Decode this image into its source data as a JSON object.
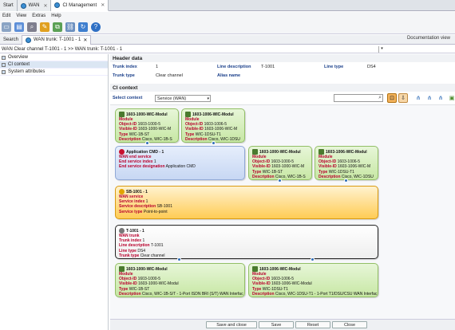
{
  "app_tabs": [
    {
      "label": "Start"
    },
    {
      "label": "WAN"
    },
    {
      "label": "CI Management"
    }
  ],
  "menu": [
    "Edit",
    "View",
    "Extras",
    "Help"
  ],
  "toolbar_icons": [
    "new-icon",
    "open-icon",
    "edit-icon",
    "copy-icon",
    "link-icon",
    "refresh-icon",
    "help-icon"
  ],
  "sub_tabs": {
    "search": "Search",
    "wan_trunk": "WAN trunk: T-1001 - 1",
    "doc_view": "Documentation view"
  },
  "breadcrumb": "WAN Clear channel T-1001 - 1 >> WAN trunk: T-1001 - 1",
  "sidebar": [
    {
      "label": "Overview"
    },
    {
      "label": "CI context"
    },
    {
      "label": "System attributes"
    }
  ],
  "header": {
    "title": "Header data",
    "trunk_index_label": "Trunk index",
    "trunk_index": "1",
    "line_desc_label": "Line description",
    "line_desc": "T-1001",
    "line_type_label": "Line type",
    "line_type": "DS4",
    "trunk_type_label": "Trunk type",
    "trunk_type": "Clear channel",
    "alias_label": "Alias name"
  },
  "ci_context": {
    "title": "CI context",
    "select_label": "Select context",
    "select_value": "Service (WAN)"
  },
  "nodes": {
    "m1": {
      "title": "1603-1000-WIC-Modul",
      "type_line": "Module",
      "oid_k": "Object-ID",
      "oid": "1603-1000-5",
      "vid_k": "Visible-ID",
      "vid": "1603-1000-WIC-M",
      "t_k": "Type",
      "t": "WIC-1B-ST",
      "d_k": "Description",
      "d": "Cisco, WIC-1B-S"
    },
    "m2": {
      "title": "1603-1006-WIC-Modul",
      "type_line": "Module",
      "oid_k": "Object-ID",
      "oid": "1603-1006-5",
      "vid_k": "Visible-ID",
      "vid": "1603-1006-WIC-M",
      "t_k": "Type",
      "t": "WIC-1DSU-T1",
      "d_k": "Description",
      "d": "Cisco, WIC-1DSU"
    },
    "app": {
      "title": "Application CMD - 1",
      "type_line": "WAN end service",
      "i_k": "End service index",
      "i": "1",
      "d_k": "End service designation",
      "d": "Application CMD"
    },
    "m3": {
      "title": "1603-1000-WIC-Modul",
      "type_line": "Module",
      "oid_k": "Object-ID",
      "oid": "1603-1000-5",
      "vid_k": "Visible-ID",
      "vid": "1603-1000-WIC-M",
      "t_k": "Type",
      "t": "WIC-1B-ST",
      "d_k": "Description",
      "d": "Cisco, WIC-1B-S"
    },
    "m4": {
      "title": "1603-1006-WIC-Modul",
      "type_line": "Module",
      "oid_k": "Object-ID",
      "oid": "1603-1006-5",
      "vid_k": "Visible-ID",
      "vid": "1603-1006-WIC-M",
      "t_k": "Type",
      "t": "WIC-1DSU-T1",
      "d_k": "Description",
      "d": "Cisco, WIC-1DSU"
    },
    "svc": {
      "title": "SB-1001 - 1",
      "type_line": "WAN service",
      "i_k": "Service index",
      "i": "1",
      "d_k": "Service description",
      "d": "SB-1001",
      "t_k": "Service type",
      "t": "Point-to-point"
    },
    "trunk": {
      "title": "T-1001 - 1",
      "type_line": "WAN trunk",
      "i_k": "Trunk index",
      "i": "1",
      "ld_k": "Line description",
      "ld": "T-1001",
      "lt_k": "Line type",
      "lt": "DS4",
      "tt_k": "Trunk type",
      "tt": "Clear channel"
    },
    "m5": {
      "title": "1603-1000-WIC-Modul",
      "type_line": "Module",
      "oid_k": "Object-ID",
      "oid": "1603-1000-5",
      "vid_k": "Visible-ID",
      "vid": "1603-1000-WIC-Modul",
      "t_k": "Type",
      "t": "WIC-1B-ST",
      "d_k": "Description",
      "d": "Cisco, WIC-1B-S/T - 1-Port ISDN BRI (S/T) WAN Interfac"
    },
    "m6": {
      "title": "1603-1006-WIC-Modul",
      "type_line": "Module",
      "oid_k": "Object-ID",
      "oid": "1603-1006-5",
      "vid_k": "Visible-ID",
      "vid": "1603-1006-WIC-Modul",
      "t_k": "Type",
      "t": "WIC-1DSU-T1",
      "d_k": "Description",
      "d": "Cisco, WIC-1DSU-T1 - 1-Port T1/DSU/CSU WAN Interfac"
    }
  },
  "buttons": {
    "save_close": "Save and close",
    "save": "Save",
    "reset": "Reset",
    "close": "Close"
  }
}
